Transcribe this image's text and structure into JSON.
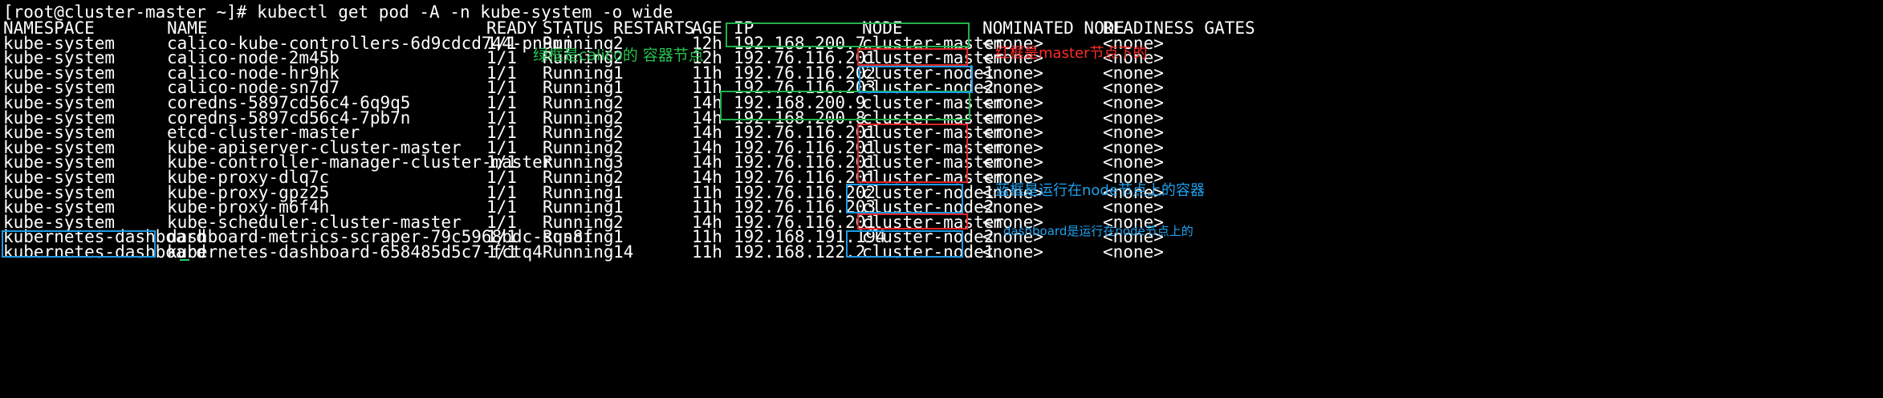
{
  "prompt": "[root@cluster-master ~]# kubectl get pod -A -n kube-system -o wide",
  "headers": [
    "NAMESPACE",
    "NAME",
    "READY",
    "STATUS",
    "RESTARTS",
    "AGE",
    "IP",
    "NODE",
    "NOMINATED NODE",
    "READINESS GATES"
  ],
  "rows": [
    [
      "kube-system",
      "calico-kube-controllers-6d9cdcd744-pn9mj",
      "1/1",
      "Running",
      "2",
      "12h",
      "192.168.200.7",
      "cluster-master",
      "<none>",
      "<none>"
    ],
    [
      "kube-system",
      "calico-node-2m45b",
      "1/1",
      "Running",
      "2",
      "12h",
      "192.76.116.201",
      "cluster-master",
      "<none>",
      "<none>"
    ],
    [
      "kube-system",
      "calico-node-hr9hk",
      "1/1",
      "Running",
      "1",
      "11h",
      "192.76.116.202",
      "cluster-node1",
      "<none>",
      "<none>"
    ],
    [
      "kube-system",
      "calico-node-sn7d7",
      "1/1",
      "Running",
      "1",
      "11h",
      "192.76.116.203",
      "cluster-node2",
      "<none>",
      "<none>"
    ],
    [
      "kube-system",
      "coredns-5897cd56c4-6q9q5",
      "1/1",
      "Running",
      "2",
      "14h",
      "192.168.200.9",
      "cluster-master",
      "<none>",
      "<none>"
    ],
    [
      "kube-system",
      "coredns-5897cd56c4-7pb7n",
      "1/1",
      "Running",
      "2",
      "14h",
      "192.168.200.8",
      "cluster-master",
      "<none>",
      "<none>"
    ],
    [
      "kube-system",
      "etcd-cluster-master",
      "1/1",
      "Running",
      "2",
      "14h",
      "192.76.116.201",
      "cluster-master",
      "<none>",
      "<none>"
    ],
    [
      "kube-system",
      "kube-apiserver-cluster-master",
      "1/1",
      "Running",
      "2",
      "14h",
      "192.76.116.201",
      "cluster-master",
      "<none>",
      "<none>"
    ],
    [
      "kube-system",
      "kube-controller-manager-cluster-master",
      "1/1",
      "Running",
      "3",
      "14h",
      "192.76.116.201",
      "cluster-master",
      "<none>",
      "<none>"
    ],
    [
      "kube-system",
      "kube-proxy-dlq7c",
      "1/1",
      "Running",
      "2",
      "14h",
      "192.76.116.201",
      "cluster-master",
      "<none>",
      "<none>"
    ],
    [
      "kube-system",
      "kube-proxy-gpz25",
      "1/1",
      "Running",
      "1",
      "11h",
      "192.76.116.202",
      "cluster-node1",
      "<none>",
      "<none>"
    ],
    [
      "kube-system",
      "kube-proxy-m6f4h",
      "1/1",
      "Running",
      "1",
      "11h",
      "192.76.116.203",
      "cluster-node2",
      "<none>",
      "<none>"
    ],
    [
      "kube-system",
      "kube-scheduler-cluster-master",
      "1/1",
      "Running",
      "2",
      "14h",
      "192.76.116.201",
      "cluster-master",
      "<none>",
      "<none>"
    ],
    [
      "kubernetes-dashboard",
      "dashboard-metrics-scraper-79c5968bdc-sqs8f",
      "1/1",
      "Running",
      "1",
      "11h",
      "192.168.191.194",
      "cluster-node2",
      "<none>",
      "<none>"
    ],
    [
      "kubernetes-dashboard",
      "kubernetes-dashboard-658485d5c7-fctq4",
      "1/1",
      "Running",
      "14",
      "11h",
      "192.168.122.2",
      "cluster-node1",
      "<none>",
      "<none>"
    ]
  ],
  "annotations": {
    "green_note": "绿框是calico的 容器节点",
    "red_note": "红框是master节点下的",
    "blue_note": "蓝框是运行在node节点上的容器",
    "dashboard_note": "dashboard是运行在node节点上的"
  },
  "colors": {
    "background": "#000000",
    "text": "#ffffff",
    "green_box": "#22b14c",
    "red_box": "#e02424",
    "blue_box": "#1c9be6",
    "green_note": "#27c250",
    "red_note": "#ff2a2a",
    "blue_note": "#1fa2ef"
  }
}
